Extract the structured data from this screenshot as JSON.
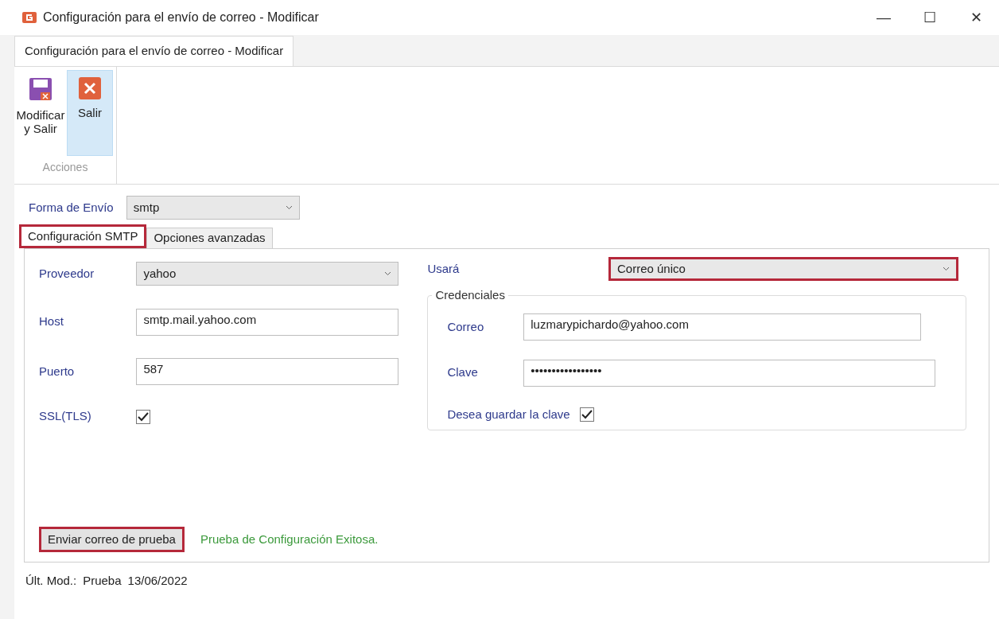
{
  "window": {
    "title": "Configuración para el envío de correo - Modificar",
    "controls": [
      "—",
      "☐",
      "✕"
    ]
  },
  "ribbon": {
    "tab": "Configuración para el envío de correo - Modificar",
    "group": "Acciones",
    "buttons": [
      {
        "kind": "save",
        "label": "Modificar y Salir",
        "selected": false
      },
      {
        "kind": "exit",
        "label": "Salir",
        "selected": true
      }
    ]
  },
  "send_method": {
    "label": "Forma de Envío",
    "value": "smtp"
  },
  "tabs": [
    {
      "label": "Configuración SMTP",
      "selected": true,
      "highlighted": true
    },
    {
      "label": "Opciones avanzadas",
      "selected": false,
      "highlighted": false
    }
  ],
  "smtp": {
    "provider": {
      "label": "Proveedor",
      "value": "yahoo"
    },
    "host": {
      "label": "Host",
      "value": "smtp.mail.yahoo.com"
    },
    "port": {
      "label": "Puerto",
      "value": "587"
    },
    "ssl": {
      "label": "SSL(TLS)",
      "checked": true
    },
    "use": {
      "label": "Usará",
      "value": "Correo único",
      "highlighted": true
    },
    "credentials": {
      "title": "Credenciales",
      "email": {
        "label": "Correo",
        "value": "luzmarypichardo@yahoo.com"
      },
      "password": {
        "label": "Clave",
        "value": "•••••••••••••••••"
      },
      "save_password": {
        "label": "Desea guardar la clave",
        "checked": true
      }
    },
    "test_button": {
      "label": "Enviar correo de prueba",
      "highlighted": true
    },
    "result": "Prueba de Configuración Exitosa."
  },
  "status_bar": {
    "label": "Últ. Mod.:",
    "user": "Prueba",
    "date": "13/06/2022"
  }
}
